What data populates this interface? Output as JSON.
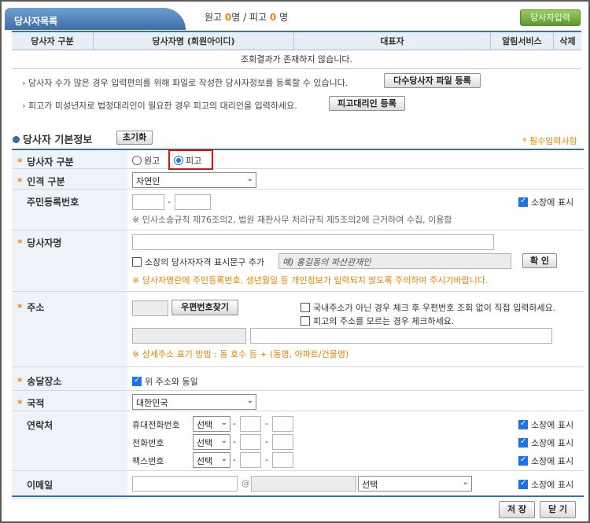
{
  "header": {
    "tab_title": "당사자목록",
    "count": {
      "plaintiff_label": "원고",
      "plaintiff_count": "0",
      "defendant_label": "명 / 피고",
      "defendant_count": "0",
      "suffix": "명"
    },
    "input_button": "당사자입력"
  },
  "list": {
    "columns": [
      "당사자 구분",
      "당사자명 (회원아이디)",
      "대표자",
      "알림서비스",
      "삭제"
    ],
    "empty_message": "조회결과가 존재하지 않습니다."
  },
  "notes": {
    "bulk_text": "당사자 수가 많은 경우 입력편의를 위해 파일로 작성한 당사자정보를 등록할 수 있습니다.",
    "bulk_button": "다수당사자 파일 등록",
    "minor_text": "피고가 미성년자로 법정대리인이 필요한 경우 피고의 대리인을 입력하세요.",
    "minor_button": "피고대리인 등록"
  },
  "section": {
    "title": "당사자 기본정보",
    "reset_button": "초기화",
    "required_note": "* 필수입력사항"
  },
  "form": {
    "party_type": {
      "label": "당사자 구분",
      "options": [
        "원고",
        "피고"
      ],
      "selected": "피고"
    },
    "person_type": {
      "label": "인격 구분",
      "value": "자연인"
    },
    "rrn": {
      "label": "주민등록번호",
      "dash": "-",
      "display_label": "소장에 표시",
      "hint": "※ 민사소송규칙 제76조의2, 법원 재판사무 처리규칙 제5조의2에 근거하여 수집, 이용함"
    },
    "name": {
      "label": "당사자명",
      "alias_label": "소장의 당사자자격 표시문구 추가",
      "alias_placeholder": "예) 홍길동의 파산관재인",
      "confirm_button": "확 인",
      "warning": "※ 당사자명란에 주민등록번호, 생년월일 등 개인정보가 입력되지 않도록 주의하여 주시기바랍니다."
    },
    "address": {
      "label": "주소",
      "zip_button": "우편번호찾기",
      "foreign_check": "국내주소가 아닌 경우 체크 후 우편번호 조회 없이 직접 입력하세요.",
      "unknown_check": "피고의 주소를 모르는 경우 체크하세요.",
      "hint": "※ 상세주소 표기 방법 : 동 호수 등 + (동명, 아파트/건물명)"
    },
    "delivery": {
      "label": "송달장소",
      "same_label": "위 주소와 동일"
    },
    "nationality": {
      "label": "국적",
      "value": "대한민국"
    },
    "contact": {
      "label": "연락처",
      "rows": [
        {
          "label": "휴대전화번호",
          "select": "선택",
          "display_label": "소장에 표시"
        },
        {
          "label": "전화번호",
          "select": "선택",
          "display_label": "소장에 표시"
        },
        {
          "label": "팩스번호",
          "select": "선택",
          "display_label": "소장에 표시"
        }
      ]
    },
    "email": {
      "label": "이메일",
      "at": "@",
      "select": "선택",
      "display_label": "소장에 표시"
    }
  },
  "footer": {
    "save_button": "저 장",
    "close_button": "닫 기"
  },
  "colors": {
    "accent": "#3c6fa8",
    "orange": "#f08200",
    "green": "#5c9a2c",
    "highlight_red": "#e01010"
  }
}
